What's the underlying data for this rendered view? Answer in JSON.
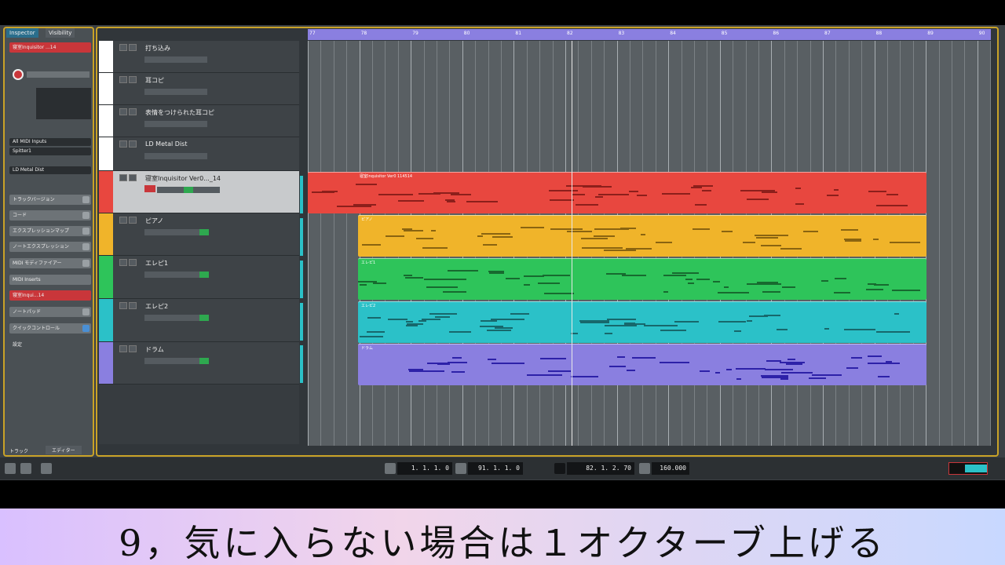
{
  "inspector": {
    "tabs": [
      "Inspector",
      "Visibility"
    ],
    "selected_track": "寝室Inquisitor ...14",
    "rows": [
      "All MIDI Inputs",
      "Spitter1",
      "LD Metal Dist"
    ],
    "sections": [
      "トラックバージョン",
      "コード",
      "エクスプレッションマップ",
      "ノートエクスプレッション",
      "MIDI モディファイアー",
      "MIDI Inserts",
      "寝室Inqui...14",
      "ノートパッド",
      "クイックコントロール",
      "設定"
    ],
    "bottom_tabs": [
      "トラック",
      "エディター"
    ]
  },
  "tracks": [
    {
      "name": "打ち込み",
      "color": "#ffffff"
    },
    {
      "name": "耳コピ",
      "color": "#ffffff"
    },
    {
      "name": "表情をつけられた耳コピ",
      "color": "#ffffff"
    },
    {
      "name": "LD Metal Dist",
      "color": "#ffffff"
    },
    {
      "name": "寝室Inquisitor Ver0..._14",
      "color": "#e8473f"
    },
    {
      "name": "ピアノ",
      "color": "#f0b42a"
    },
    {
      "name": "エレピ1",
      "color": "#2ec45a"
    },
    {
      "name": "エレピ2",
      "color": "#2bc1c8"
    },
    {
      "name": "ドラム",
      "color": "#8a7fe0"
    }
  ],
  "ruler": {
    "bars": [
      "77",
      "78",
      "79",
      "80",
      "81",
      "82",
      "83",
      "84",
      "85",
      "86",
      "87",
      "88",
      "89",
      "90"
    ]
  },
  "clips": [
    {
      "name": "寝室Inquisitor Ver0 114514",
      "color": "#e8473f"
    },
    {
      "name": "ピアノ",
      "color": "#f0b42a"
    },
    {
      "name": "エレピ1",
      "color": "#2ec45a"
    },
    {
      "name": "エレピ2",
      "color": "#2bc1c8"
    },
    {
      "name": "ドラム",
      "color": "#8a7fe0"
    }
  ],
  "transport": {
    "left_locator": "1. 1. 1.   0",
    "right_locator": "91. 1. 1.   0",
    "position": "82. 1. 2. 70",
    "tempo": "160.000"
  },
  "caption": "9，気に入らない場合は１オクターブ上げる"
}
